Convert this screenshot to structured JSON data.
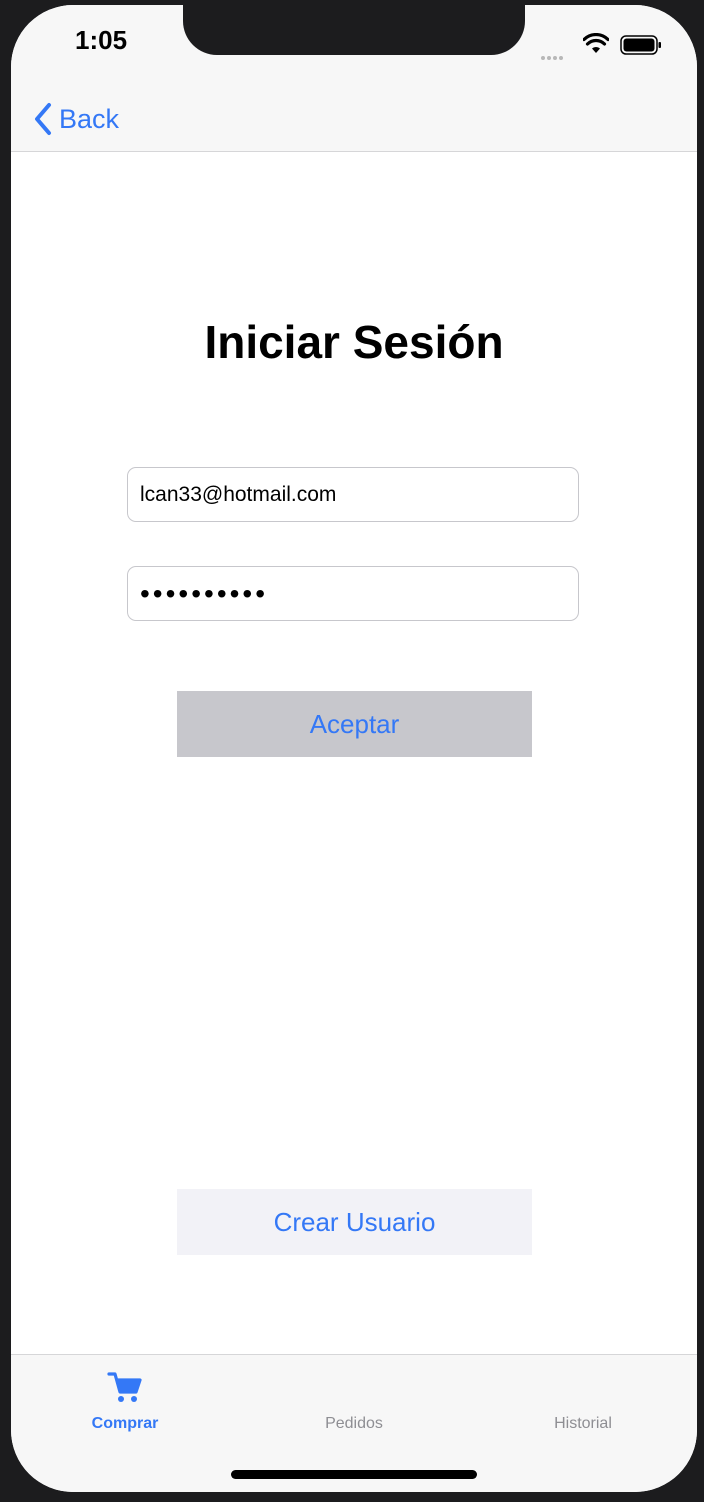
{
  "status_bar": {
    "time": "1:05",
    "icons": [
      "cellular-dots-icon",
      "wifi-icon",
      "battery-icon"
    ]
  },
  "nav": {
    "back_label": "Back",
    "back_icon": "chevron-left-icon"
  },
  "login": {
    "title": "Iniciar Sesión",
    "email_value": "lcan33@hotmail.com",
    "password_value": "••••••••••",
    "accept_label": "Aceptar",
    "create_user_label": "Crear Usuario"
  },
  "tab_bar": {
    "tabs": [
      {
        "label": "Comprar",
        "icon": "cart-icon",
        "active": true
      },
      {
        "label": "Pedidos",
        "active": false
      },
      {
        "label": "Historial",
        "active": false
      }
    ]
  },
  "colors": {
    "accent": "#3478f6",
    "accept_button_bg": "#c7c7cc",
    "create_button_bg": "#f2f2f7",
    "inactive_tab": "#8e8e93"
  }
}
